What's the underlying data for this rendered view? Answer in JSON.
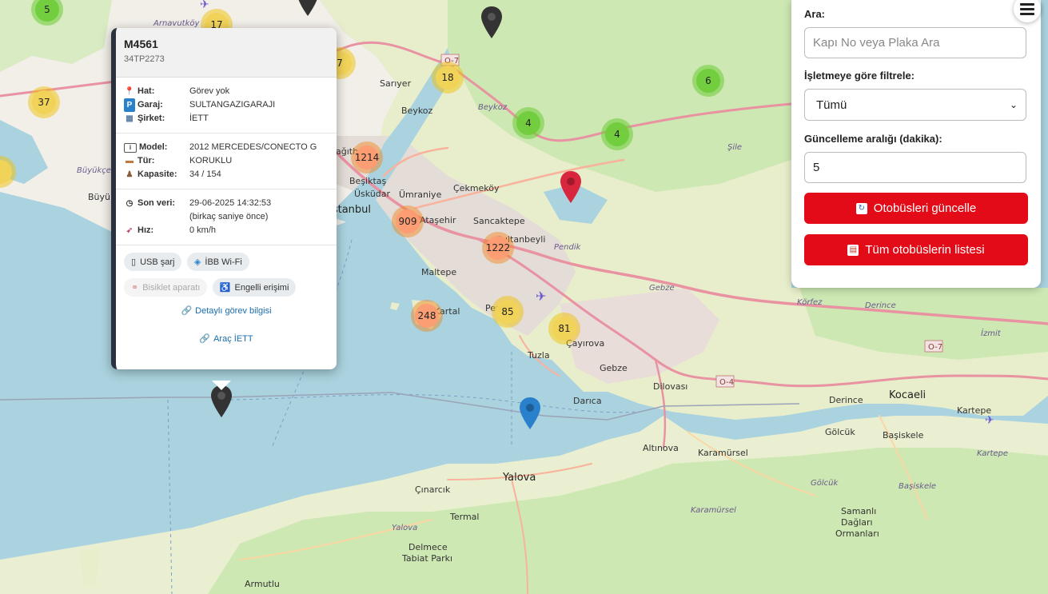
{
  "map": {
    "labels": {
      "arnavutkoy": "Arnavutköy",
      "sariyer": "Sarıyer",
      "beykoz_town": "Beykoz",
      "beykoz_dist": "Beykoz",
      "sile": "Şile",
      "kagithane": "Kağıthane",
      "besiktas": "Beşiktaş",
      "uskudar": "Üsküdar",
      "umraniye": "Ümraniye",
      "cekmekoy": "Çekmeköy",
      "istanbul": "İstanbul",
      "atasehir": "Ataşehir",
      "sancaktepe": "Sancaktepe",
      "sultanbeyli": "Sultanbeyli",
      "pendik": "Pendik",
      "maltepe": "Maltepe",
      "kartal": "Kartal",
      "pendik_town": "Pendik",
      "cayirova": "Çayırova",
      "tuzla": "Tuzla",
      "gebze_town": "Gebze",
      "gebze_dist": "Gebze",
      "korfez": "Körfez",
      "derince_dist": "Derince",
      "izmit": "İzmit",
      "derince_town": "Derince",
      "kocaeli": "Kocaeli",
      "kartepe_town": "Kartepe",
      "kartepe_dist": "Kartepe",
      "darica": "Darıca",
      "dilovasi": "Dilovası",
      "golcuk_town": "Gölcük",
      "golcuk_dist": "Gölcük",
      "basiskele_town": "Başiskele",
      "basiskele_dist": "Başiskele",
      "altinova": "Altınova",
      "karamursel_town": "Karamürsel",
      "karamursel_dist": "Karamürsel",
      "yalova_town": "Yalova",
      "yalova_dist": "Yalova",
      "cinarcik": "Çınarcık",
      "termal": "Termal",
      "delmece": "Delmece",
      "tabiat": "Tabiat Parkı",
      "samanli1": "Samanlı",
      "samanli2": "Dağları",
      "samanli3": "Ormanları",
      "armutlu": "Armutlu",
      "buyukcekmece_dist": "Büyükçek",
      "buyukcekmece_town": "Büyük",
      "o7_a": "O-7",
      "o7_b": "O-7",
      "o4": "O-4"
    },
    "clusters": [
      {
        "count": "5",
        "color": "green"
      },
      {
        "count": "17",
        "color": "yellow"
      },
      {
        "count": "7",
        "color": "yellow"
      },
      {
        "count": "18",
        "color": "yellow"
      },
      {
        "count": "6",
        "color": "green"
      },
      {
        "count": "37",
        "color": "yellow"
      },
      {
        "count": "4",
        "color": "green"
      },
      {
        "count": "4",
        "color": "green"
      },
      {
        "count": "1214",
        "color": "orange"
      },
      {
        "count": "909",
        "color": "orange"
      },
      {
        "count": "1222",
        "color": "orange"
      },
      {
        "count": "248",
        "color": "orange"
      },
      {
        "count": "85",
        "color": "yellow"
      },
      {
        "count": "81",
        "color": "yellow"
      }
    ],
    "pin_colors": {
      "dark": "#333333",
      "red": "#d7263d",
      "blue": "#2a81cb"
    }
  },
  "popup": {
    "title": "M4561",
    "plate": "34TP2273",
    "hat_label": "Hat:",
    "hat_value": "Görev yok",
    "garaj_label": "Garaj:",
    "garaj_value": "SULTANGAZIGARAJI",
    "sirket_label": "Şirket:",
    "sirket_value": "İETT",
    "model_label": "Model:",
    "model_value": "2012 MERCEDES/CONECTO G",
    "tur_label": "Tür:",
    "tur_value": "KORUKLU",
    "kapasite_label": "Kapasite:",
    "kapasite_value": "34 / 154",
    "sonveri_label": "Son veri:",
    "sonveri_value": "29-06-2025 14:32:53",
    "sonveri_rel": "(birkaç saniye önce)",
    "hiz_label": "Hız:",
    "hiz_value": "0 km/h",
    "badge_usb": "USB şarj",
    "badge_wifi": "İBB Wi-Fi",
    "badge_bike": "Bisiklet aparatı",
    "badge_access": "Engelli erişimi",
    "link_detail": "Detaylı görev bilgisi",
    "link_vehicle": "Araç İETT"
  },
  "panel": {
    "search_label": "Ara:",
    "search_placeholder": "Kapı No veya Plaka Ara",
    "filter_label": "İşletmeye göre filtrele:",
    "filter_value": "Tümü",
    "interval_label": "Güncelleme aralığı (dakika):",
    "interval_value": "5",
    "update_button": "Otobüsleri güncelle",
    "list_button": "Tüm otobüslerin listesi",
    "button_color": "#e30b17"
  }
}
